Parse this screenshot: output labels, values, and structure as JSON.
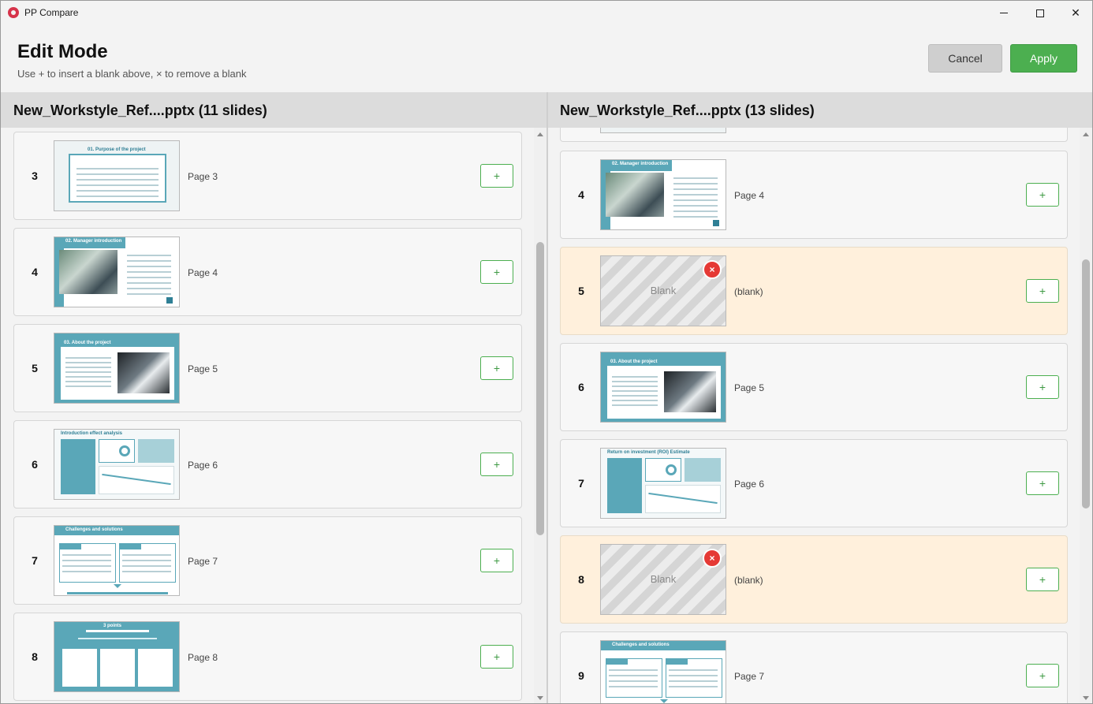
{
  "window": {
    "title": "PP Compare",
    "minimize": "—",
    "maximize": "",
    "close": "✕"
  },
  "header": {
    "title": "Edit Mode",
    "hint": "Use + to insert a blank above, × to remove a blank",
    "cancel_label": "Cancel",
    "apply_label": "Apply"
  },
  "colors": {
    "apply": "#4caf50",
    "blank_row": "#fff0dc",
    "remove": "#e53935",
    "accent": "#5aa7b8"
  },
  "left": {
    "title": "New_Workstyle_Ref....pptx (11 slides)",
    "rows": [
      {
        "num": "3",
        "label": "Page 3",
        "thumb": "purpose",
        "thumb_text": "01. Purpose of the project"
      },
      {
        "num": "4",
        "label": "Page 4",
        "thumb": "intro",
        "thumb_text": "02. Manager introduction"
      },
      {
        "num": "5",
        "label": "Page 5",
        "thumb": "about",
        "thumb_text": "03. About the project"
      },
      {
        "num": "6",
        "label": "Page 6",
        "thumb": "effect",
        "thumb_text": "Introduction effect analysis"
      },
      {
        "num": "7",
        "label": "Page 7",
        "thumb": "challenges",
        "thumb_text": "Challenges and solutions"
      },
      {
        "num": "8",
        "label": "Page 8",
        "thumb": "points",
        "thumb_text": "3 points"
      }
    ]
  },
  "right": {
    "title": "New_Workstyle_Ref....pptx (13 slides)",
    "rows": [
      {
        "num": "4",
        "label": "Page 4",
        "thumb": "intro",
        "thumb_text": "02. Manager introduction"
      },
      {
        "num": "5",
        "label": "(blank)",
        "blank": true,
        "blank_text": "Blank"
      },
      {
        "num": "6",
        "label": "Page 5",
        "thumb": "about",
        "thumb_text": "03. About the project"
      },
      {
        "num": "7",
        "label": "Page 6",
        "thumb": "effect",
        "thumb_text": "Return on investment (ROI) Estimate"
      },
      {
        "num": "8",
        "label": "(blank)",
        "blank": true,
        "blank_text": "Blank"
      },
      {
        "num": "9",
        "label": "Page 7",
        "thumb": "challenges",
        "thumb_text": "Challenges and solutions"
      }
    ]
  },
  "buttons": {
    "insert": "+",
    "remove": "×"
  }
}
